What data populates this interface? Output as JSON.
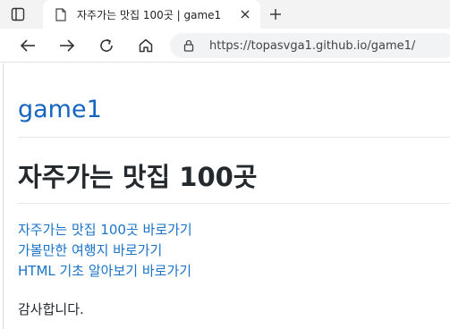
{
  "browser": {
    "tab": {
      "title": "자주가는 맛집 100곳 | game1"
    },
    "address": {
      "url": "https://topasvga1.github.io/game1/"
    },
    "icons": [
      "sidebar-icon",
      "page-icon",
      "close-icon",
      "plus-icon",
      "arrow-left-icon",
      "arrow-right-icon",
      "reload-icon",
      "home-icon",
      "lock-icon"
    ]
  },
  "site": {
    "title": "game1"
  },
  "main": {
    "heading": "자주가는 맛집 100곳",
    "links": [
      {
        "label": "자주가는 맛집 100곳 바로가기"
      },
      {
        "label": "가볼만한 여행지 바로가기"
      },
      {
        "label": "HTML 기초 알아보기 바로가기"
      }
    ],
    "closing": "감사합니다."
  },
  "colors": {
    "link": "#1a73c8",
    "site_title": "#1565c0",
    "heading": "#24292e"
  }
}
